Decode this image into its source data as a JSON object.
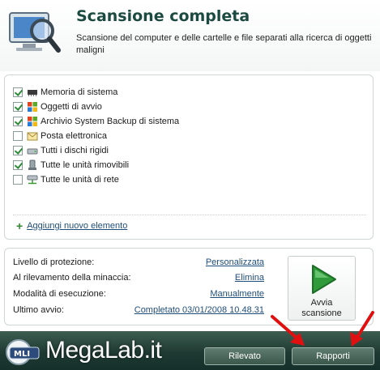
{
  "header": {
    "title": "Scansione completa",
    "subtitle": "Scansione del computer e delle cartelle e file separati alla ricerca di oggetti maligni"
  },
  "scan_objects": [
    {
      "label": "Memoria di sistema",
      "checked": true,
      "icon": "memory-chip-icon"
    },
    {
      "label": "Oggetti di avvio",
      "checked": true,
      "icon": "windows-flag-icon"
    },
    {
      "label": "Archivio System Backup di sistema",
      "checked": true,
      "icon": "windows-flag-icon"
    },
    {
      "label": "Posta elettronica",
      "checked": false,
      "icon": "mail-icon"
    },
    {
      "label": "Tutti i dischi rigidi",
      "checked": true,
      "icon": "hard-disk-icon"
    },
    {
      "label": "Tutte le unità rimovibili",
      "checked": true,
      "icon": "removable-drive-icon"
    },
    {
      "label": "Tutte le unità di rete",
      "checked": false,
      "icon": "network-drive-icon"
    }
  ],
  "add_item": {
    "label": "Aggiungi nuovo elemento"
  },
  "settings": {
    "protection_level": {
      "label": "Livello di protezione:",
      "value": "Personalizzata"
    },
    "on_detection": {
      "label": "Al rilevamento della minaccia:",
      "value": "Elimina"
    },
    "run_mode": {
      "label": "Modalità di esecuzione:",
      "value": "Manualmente"
    },
    "last_run": {
      "label": "Ultimo avvio:",
      "value": "Completato 03/01/2008 10.48.31"
    }
  },
  "start_button": {
    "line1": "Avvia",
    "line2": "scansione"
  },
  "footer": {
    "logo_text": "MegaLab.it",
    "detected_button": "Rilevato",
    "reports_button": "Rapporti"
  },
  "colors": {
    "title": "#1b4a40",
    "link": "#1f4d7a",
    "footer_bg": "#1f3a32",
    "arrow": "#e01010",
    "play": "#2f9a3a"
  }
}
